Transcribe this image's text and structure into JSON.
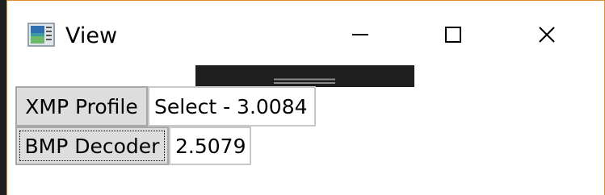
{
  "window": {
    "title": "View",
    "icon": "picture-viewer-icon",
    "controls": {
      "minimize": "minimize-icon",
      "maximize": "maximize-icon",
      "close": "close-icon"
    }
  },
  "toolbar": {
    "grip": "drag-grip-icon"
  },
  "rows": [
    {
      "button_label": "XMP Profile",
      "value": "Select - 3.0084"
    },
    {
      "button_label": "BMP Decoder",
      "value": "2.5079"
    }
  ],
  "colors": {
    "window_border": "#e0893a",
    "button_face": "#dddddd",
    "dark_strip": "#1e1e1e"
  }
}
